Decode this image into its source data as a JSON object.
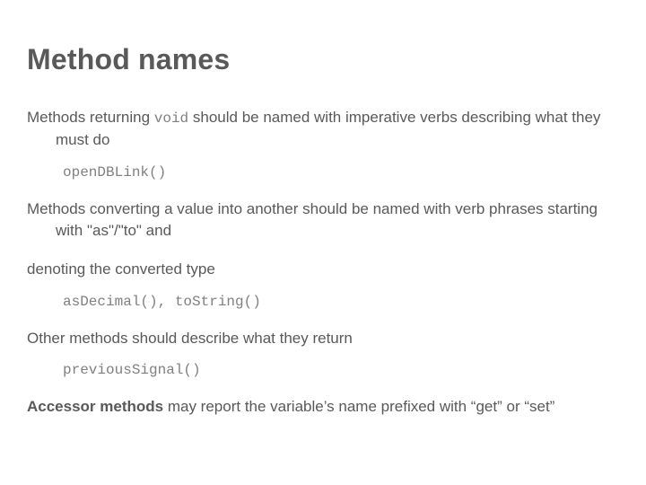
{
  "title": "Method names",
  "para1_a": "Methods returning ",
  "para1_code": "void",
  "para1_b": " should be named with imperative verbs describing what they must do",
  "code1": "openDBLink()",
  "para2": "Methods converting a value into another should be named with verb phrases starting with \"as\"/\"to\" and",
  "para3": "denoting the converted type",
  "code2": "asDecimal(), toString()",
  "para4": "Other methods should describe what they return",
  "code3": "previousSignal()",
  "para5_bold": "Accessor methods",
  "para5_b": " may report the variable’s name prefixed with “get” or “set”"
}
